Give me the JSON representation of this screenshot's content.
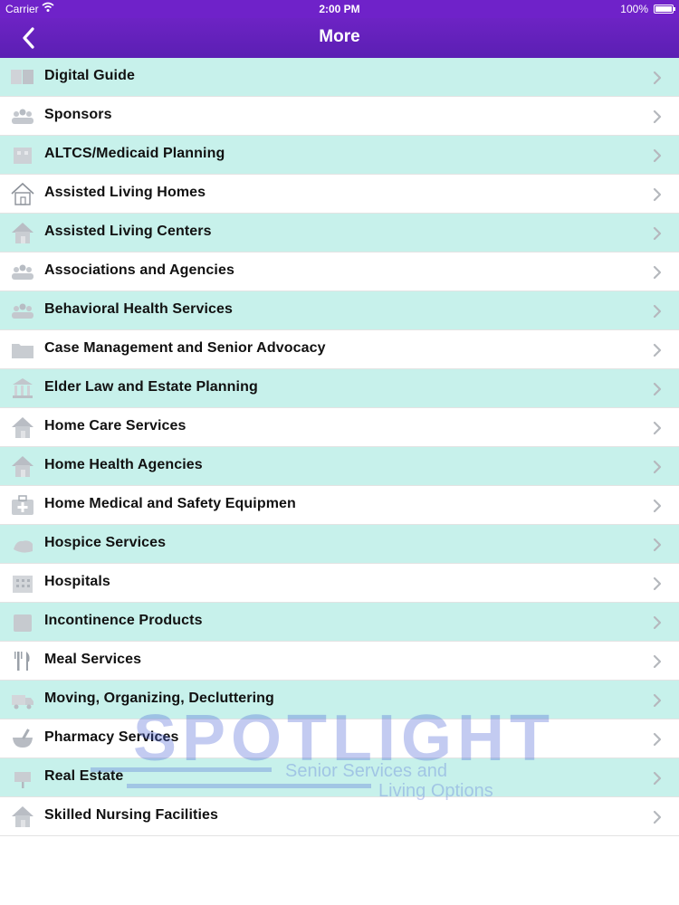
{
  "status_bar": {
    "carrier": "Carrier",
    "time": "2:00 PM",
    "battery": "100%"
  },
  "nav": {
    "title": "More"
  },
  "menu": {
    "items": [
      {
        "label": "Digital Guide",
        "icon": "book-icon"
      },
      {
        "label": "Sponsors",
        "icon": "people-icon"
      },
      {
        "label": "ALTCS/Medicaid Planning",
        "icon": "building-icon"
      },
      {
        "label": "Assisted Living Homes",
        "icon": "house-outline-icon"
      },
      {
        "label": "Assisted Living Centers",
        "icon": "house-icon"
      },
      {
        "label": "Associations and Agencies",
        "icon": "people-icon"
      },
      {
        "label": "Behavioral Health Services",
        "icon": "people-icon"
      },
      {
        "label": "Case Management and Senior Advocacy",
        "icon": "folder-icon"
      },
      {
        "label": "Elder Law and Estate Planning",
        "icon": "courthouse-icon"
      },
      {
        "label": "Home Care Services",
        "icon": "house-icon"
      },
      {
        "label": "Home Health Agencies",
        "icon": "house-icon"
      },
      {
        "label": "Home Medical and Safety Equipmen",
        "icon": "medical-kit-icon"
      },
      {
        "label": "Hospice Services",
        "icon": "hand-icon"
      },
      {
        "label": "Hospitals",
        "icon": "hospital-icon"
      },
      {
        "label": "Incontinence Products",
        "icon": "box-icon"
      },
      {
        "label": "Meal Services",
        "icon": "fork-knife-icon"
      },
      {
        "label": "Moving, Organizing, Decluttering",
        "icon": "truck-icon"
      },
      {
        "label": "Pharmacy Services",
        "icon": "mortar-pestle-icon"
      },
      {
        "label": "Real Estate",
        "icon": "sign-icon"
      },
      {
        "label": "Skilled Nursing Facilities",
        "icon": "house-icon"
      }
    ]
  },
  "watermark": {
    "brand": "SPOTLIGHT",
    "tagline_1": "Senior Services and",
    "tagline_2": "Living Options",
    "color": "#4a63d6"
  }
}
